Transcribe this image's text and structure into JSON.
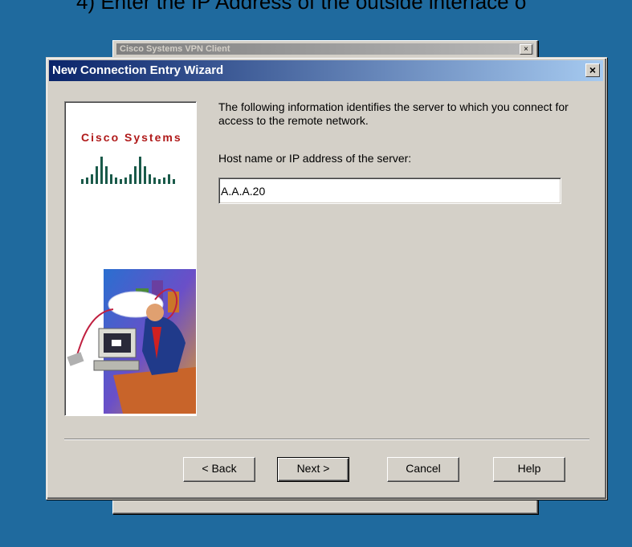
{
  "instruction": "4) Enter the IP Address of the outside interface o",
  "background_window": {
    "title": "Cisco Systems VPN Client"
  },
  "dialog": {
    "title": "New Connection Entry Wizard",
    "close_label": "✕",
    "brand_text": "Cisco Systems",
    "info_text": "The following information identifies the server to which you connect for access to the remote network.",
    "field_label": "Host name or IP address of the server:",
    "host_value": "A.A.A.20",
    "buttons": {
      "back": "< Back",
      "next": "Next >",
      "cancel": "Cancel",
      "help": "Help"
    }
  },
  "colors": {
    "desktop": "#1f6a9e",
    "titlebar_start": "#0a246a",
    "titlebar_end": "#a6caf0",
    "face": "#d4d0c8",
    "brand": "#b01a1a"
  }
}
